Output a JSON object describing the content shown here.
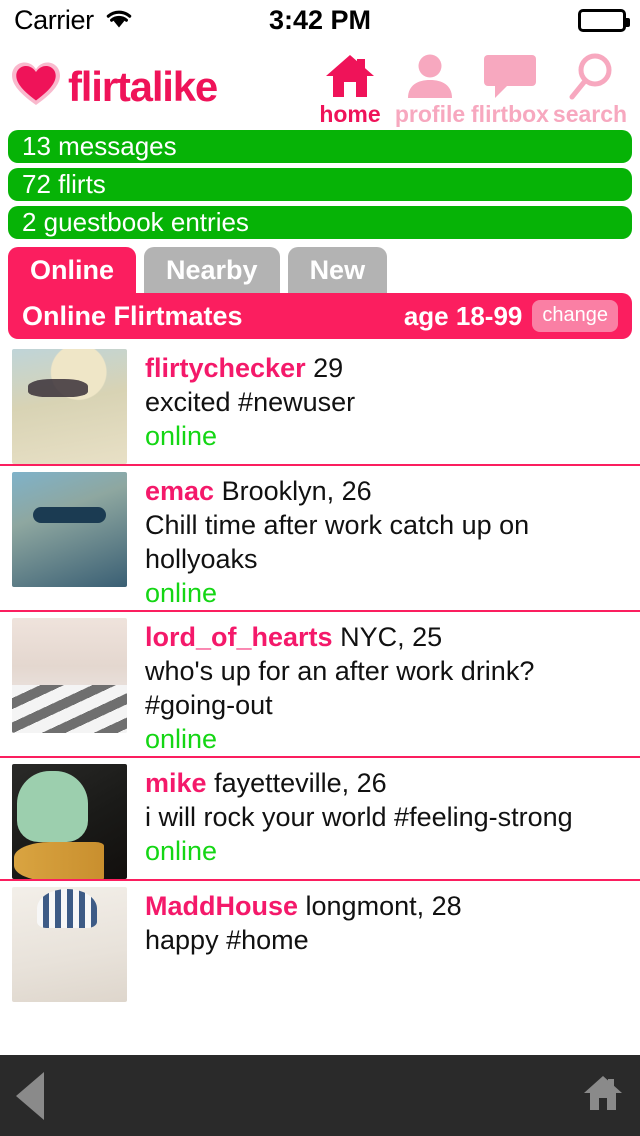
{
  "status_bar": {
    "carrier": "Carrier",
    "wifi_icon": "wifi-icon",
    "time": "3:42 PM",
    "battery_icon": "battery-full-icon"
  },
  "brand": {
    "logo_text": "flirtalike",
    "logo_icon": "heart-icon",
    "accent_color": "#ef1359"
  },
  "nav": {
    "items": [
      {
        "label": "home",
        "icon": "home-icon",
        "active": true
      },
      {
        "label": "profile",
        "icon": "person-icon",
        "active": false
      },
      {
        "label": "flirtbox",
        "icon": "speech-bubble-icon",
        "active": false
      },
      {
        "label": "search",
        "icon": "magnifier-icon",
        "active": false
      }
    ]
  },
  "notices": [
    {
      "text": "13 messages"
    },
    {
      "text": "72 flirts"
    },
    {
      "text": "2 guestbook entries"
    }
  ],
  "tabs": [
    {
      "label": "Online",
      "active": true
    },
    {
      "label": "Nearby",
      "active": false
    },
    {
      "label": "New",
      "active": false
    }
  ],
  "subbar": {
    "title": "Online Flirtmates",
    "age_label": "age 18-99",
    "change_label": "change"
  },
  "list": [
    {
      "username": "flirtychecker",
      "details": "29",
      "blurb": "excited #newuser",
      "status": "online",
      "photo": "ph1"
    },
    {
      "username": "emac",
      "details": "Brooklyn, 26",
      "blurb": "Chill time after work catch up on hollyoaks",
      "status": "online",
      "photo": "ph2"
    },
    {
      "username": "lord_of_hearts",
      "details": "NYC, 25",
      "blurb": "who's up for an after work drink? #going-out",
      "status": "online",
      "photo": "ph3"
    },
    {
      "username": "mike",
      "details": "fayetteville, 26",
      "blurb": "i will rock your world #feeling-strong",
      "status": "online",
      "photo": "ph4"
    },
    {
      "username": "MaddHouse",
      "details": "longmont, 28",
      "blurb": "happy #home",
      "status": "",
      "photo": "ph5"
    }
  ],
  "bottom_bar": {
    "back_icon": "back-triangle-icon",
    "home_icon": "home-icon"
  },
  "colors": {
    "pink": "#fb1e5f",
    "pink_dark": "#ef1359",
    "pink_light": "#f7a8bf",
    "green": "#06b306",
    "green_text": "#14d614",
    "gray_tab": "#b3b3b3",
    "bottom_bar": "#2a2a2a"
  }
}
